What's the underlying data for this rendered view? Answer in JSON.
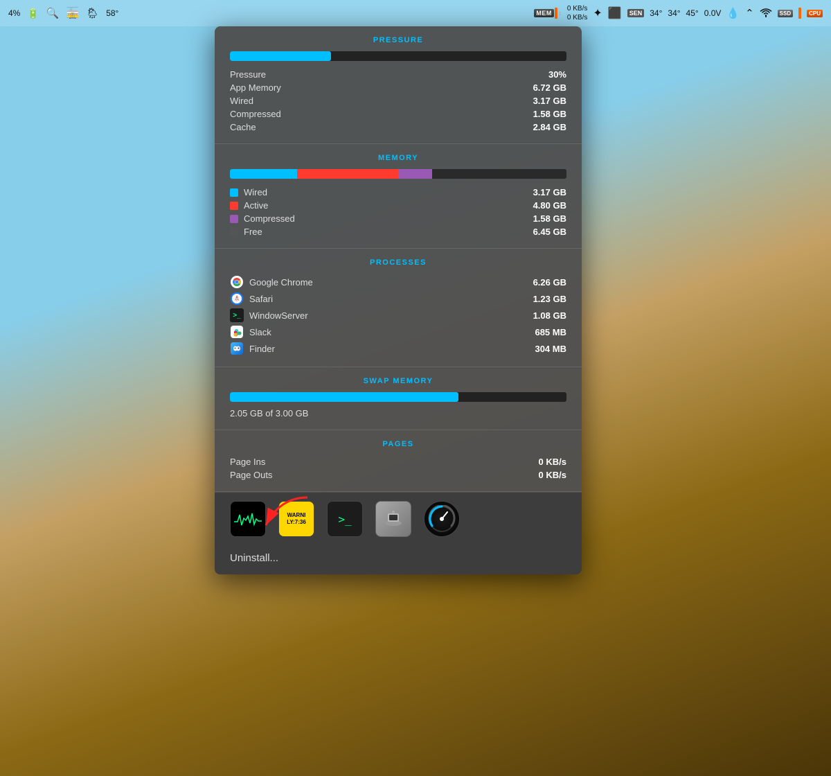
{
  "menubar": {
    "battery_pct": "4%",
    "magnify_icon": "🔍",
    "train_icon": "🚋",
    "weather_icon": "🌦",
    "temp_f": "58°",
    "mem_label": "MEM",
    "net_up": "0 KB/s",
    "net_down": "0 KB/s",
    "crosshair_icon": "✦",
    "display_icon": "▬",
    "sen_label": "SEN",
    "temp1": "34°",
    "temp2": "34°",
    "temp3": "45°",
    "voltage": "0.0V",
    "drop_icon": "💧",
    "wifi_icon": "wifi",
    "ssd_label": "SSD",
    "cpu_label": "CPU"
  },
  "popup": {
    "pressure_section": {
      "title": "PRESSURE",
      "bar_fill_pct": 30,
      "bar_color": "#00BFFF",
      "rows": [
        {
          "label": "Pressure",
          "value": "30%"
        },
        {
          "label": "App Memory",
          "value": "6.72 GB"
        },
        {
          "label": "Wired",
          "value": "3.17 GB"
        },
        {
          "label": "Compressed",
          "value": "1.58 GB"
        },
        {
          "label": "Cache",
          "value": "2.84 GB"
        }
      ]
    },
    "memory_section": {
      "title": "MEMORY",
      "segments": [
        {
          "color": "#00BFFF",
          "pct": 20
        },
        {
          "color": "#FF3B30",
          "pct": 30
        },
        {
          "color": "#9B59B6",
          "pct": 10
        },
        {
          "color": "#333",
          "pct": 40
        }
      ],
      "rows": [
        {
          "label": "Wired",
          "value": "3.17 GB",
          "color": "#00BFFF"
        },
        {
          "label": "Active",
          "value": "4.80 GB",
          "color": "#FF3B30"
        },
        {
          "label": "Compressed",
          "value": "1.58 GB",
          "color": "#9B59B6"
        },
        {
          "label": "Free",
          "value": "6.45 GB",
          "color": "#555"
        }
      ]
    },
    "processes_section": {
      "title": "PROCESSES",
      "rows": [
        {
          "label": "Google Chrome",
          "value": "6.26 GB",
          "icon": "chrome"
        },
        {
          "label": "Safari",
          "value": "1.23 GB",
          "icon": "safari"
        },
        {
          "label": "WindowServer",
          "value": "1.08 GB",
          "icon": "terminal"
        },
        {
          "label": "Slack",
          "value": "685 MB",
          "icon": "slack"
        },
        {
          "label": "Finder",
          "value": "304 MB",
          "icon": "finder"
        }
      ]
    },
    "swap_section": {
      "title": "SWAP MEMORY",
      "bar_fill_pct": 68,
      "bar_color": "#00BFFF",
      "label": "2.05 GB of 3.00 GB"
    },
    "pages_section": {
      "title": "PAGES",
      "rows": [
        {
          "label": "Page Ins",
          "value": "0 KB/s"
        },
        {
          "label": "Page Outs",
          "value": "0 KB/s"
        }
      ]
    }
  },
  "dock": {
    "icons": [
      {
        "name": "Activity Monitor",
        "type": "activity"
      },
      {
        "name": "Console",
        "type": "console"
      },
      {
        "name": "Terminal",
        "type": "terminal"
      },
      {
        "name": "System Information",
        "type": "info"
      },
      {
        "name": "iStatistica",
        "type": "ispeed"
      }
    ],
    "uninstall_label": "Uninstall..."
  }
}
